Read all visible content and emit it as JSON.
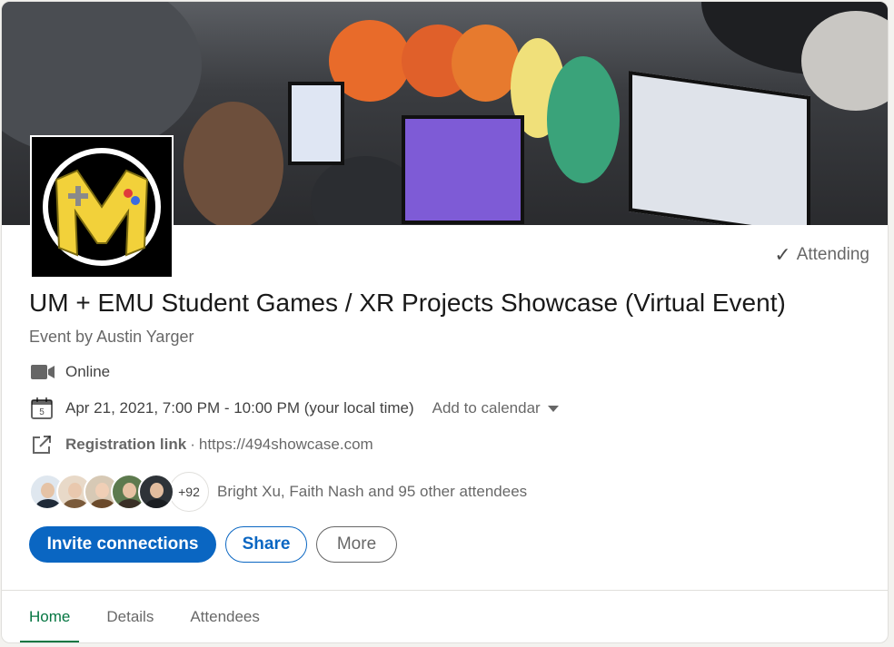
{
  "event": {
    "status": "Attending",
    "title": "UM + EMU Student Games / XR Projects Showcase (Virtual Event)",
    "by_prefix": "Event by",
    "organizer": "Austin Yarger",
    "location": "Online",
    "datetime": "Apr 21, 2021, 7:00 PM - 10:00 PM (your local time)",
    "add_to_calendar": "Add to calendar",
    "calendar_day": "5",
    "registration_label": "Registration link",
    "registration_separator": "·",
    "registration_url": "https://494showcase.com"
  },
  "attendees": {
    "extra_count": "+92",
    "summary": "Bright Xu, Faith Nash and 95 other attendees",
    "avatars": [
      {
        "name": "avatar-1",
        "bg": "#dfe7ef",
        "face": "#e5c3a6",
        "body": "#1f2a38"
      },
      {
        "name": "avatar-2",
        "bg": "#e8d9c8",
        "face": "#e9c8ae",
        "body": "#7a5a3a"
      },
      {
        "name": "avatar-3",
        "bg": "#d7c9b5",
        "face": "#f0cfb6",
        "body": "#6b4a2b"
      },
      {
        "name": "avatar-4",
        "bg": "#5d7a4e",
        "face": "#e6c2a3",
        "body": "#3a2f26"
      },
      {
        "name": "avatar-5",
        "bg": "#2e3338",
        "face": "#e2bd9f",
        "body": "#1b1e22"
      }
    ]
  },
  "actions": {
    "invite": "Invite connections",
    "share": "Share",
    "more": "More"
  },
  "tabs": {
    "home": "Home",
    "details": "Details",
    "attendees": "Attendees"
  },
  "colors": {
    "primary": "#0a66c2",
    "active_tab": "#057642",
    "logo_yellow": "#f2d13a"
  }
}
